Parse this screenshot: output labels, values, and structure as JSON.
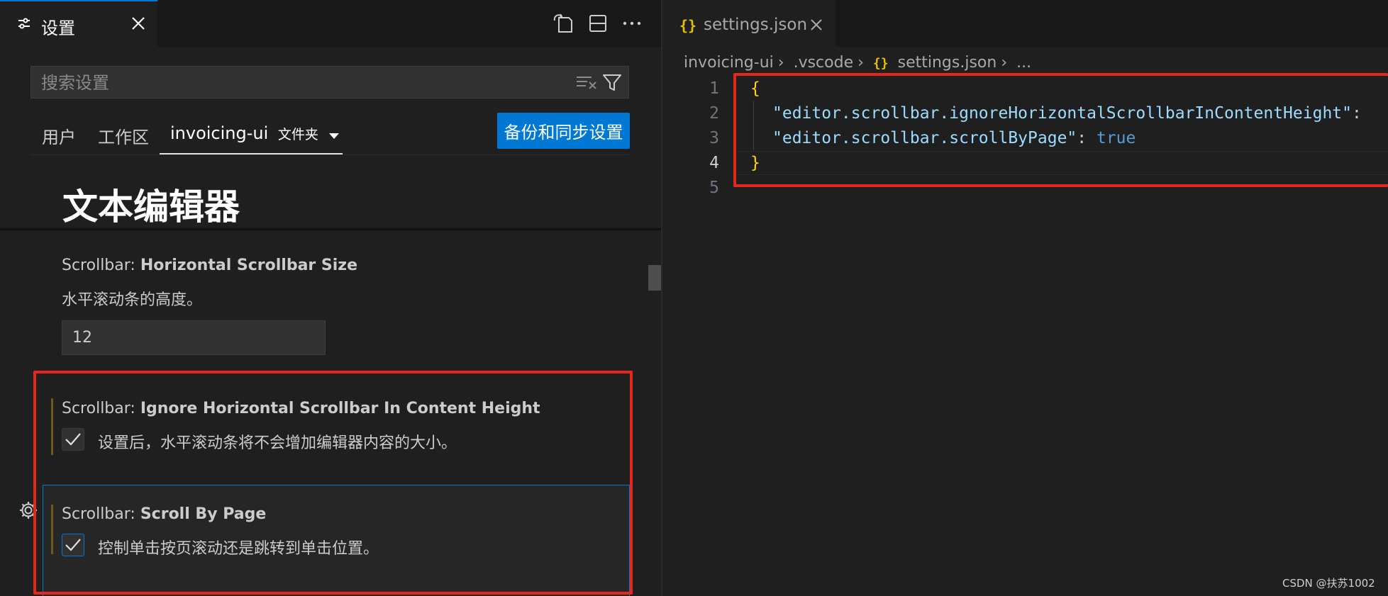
{
  "left_panel": {
    "tab": {
      "icon": "settings-sliders-icon",
      "title": "设置",
      "close_icon": "close-icon"
    },
    "toolbar_icons": [
      "open-settings-json-icon",
      "split-editor-icon",
      "more-actions-icon"
    ],
    "search": {
      "placeholder": "搜索设置",
      "clear_icon": "clear-filter-icon",
      "filter_icon": "filter-icon"
    },
    "scope_tabs": [
      {
        "label": "用户"
      },
      {
        "label": "工作区"
      },
      {
        "label": "invoicing-ui",
        "suffix": "文件夹",
        "active": true
      }
    ],
    "sync_button": "备份和同步设置",
    "section_title": "文本编辑器",
    "settings": [
      {
        "category": "Scrollbar: ",
        "name": "Horizontal Scrollbar Size",
        "description": "水平滚动条的高度。",
        "value": "12"
      },
      {
        "category": "Scrollbar: ",
        "name": "Ignore Horizontal Scrollbar In Content Height",
        "description": "设置后，水平滚动条将不会增加编辑器内容的大小。",
        "checked": true
      },
      {
        "category": "Scrollbar: ",
        "name": "Scroll By Page",
        "description": "控制单击按页滚动还是跳转到单击位置。",
        "checked": true
      }
    ]
  },
  "right_panel": {
    "tab": {
      "icon_text": "{}",
      "title": "settings.json",
      "close_icon": "close-icon"
    },
    "breadcrumb": [
      "invoicing-ui",
      ".vscode",
      "settings.json",
      "..."
    ],
    "code_lines": [
      {
        "num": "1",
        "text": "{"
      },
      {
        "num": "2",
        "key": "\"editor.scrollbar.ignoreHorizontalScrollbarInContentHeight\"",
        "sep": ":"
      },
      {
        "num": "3",
        "key": "\"editor.scrollbar.scrollByPage\"",
        "sep": ": ",
        "value": "true"
      },
      {
        "num": "4",
        "text": "}"
      },
      {
        "num": "5",
        "text": ""
      }
    ]
  },
  "watermark": "CSDN @扶苏1002",
  "colors": {
    "accent": "#0078d4",
    "highlight_box": "#e5281a",
    "string": "#9cdcfe",
    "keyword": "#569cd6",
    "brace": "#ffd700"
  }
}
